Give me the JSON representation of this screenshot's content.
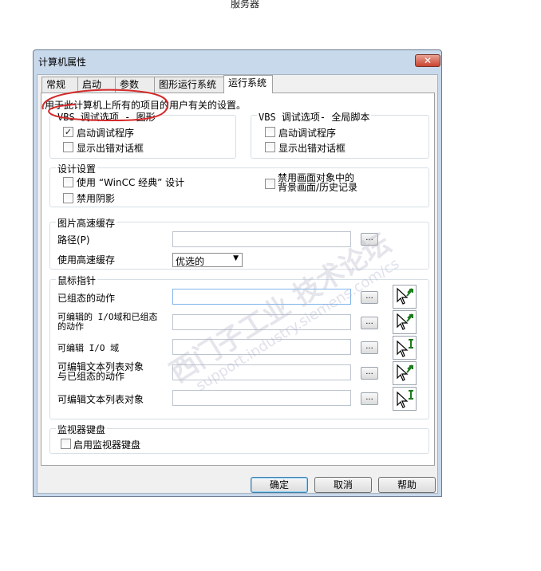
{
  "top_label": "服务器",
  "window": {
    "title": "计算机属性",
    "close": "✕"
  },
  "tabs": [
    "常规",
    "启动",
    "参数",
    "图形运行系统",
    "运行系统"
  ],
  "description": "用于此计算机上所有的项目的用户有关的设置。",
  "vbs_graphics": {
    "title": "VBS 调试选项 - 图形",
    "start_debugger": "启动调试程序",
    "show_error_dialog": "显示出错对话框"
  },
  "vbs_global": {
    "title": "VBS 调试选项- 全局脚本",
    "start_debugger": "启动调试程序",
    "show_error_dialog": "显示出错对话框"
  },
  "design": {
    "title": "设计设置",
    "classic_design": "使用 “WinCC 经典” 设计",
    "disable_shadow": "禁用阴影",
    "disable_screen_objects_line1": "禁用画面对象中的",
    "disable_screen_objects_line2": "背景画面/历史记录"
  },
  "image_cache": {
    "title": "图片高速缓存",
    "path_label": "路径(P)",
    "use_cache_label": "使用高速缓存",
    "use_cache_value": "优选的"
  },
  "mouse_pointer": {
    "title": "鼠标指针",
    "rows": [
      {
        "label1": "已组态的动作",
        "label2": ""
      },
      {
        "label1": "可编辑的 I/O域和已组态",
        "label2": "的动作"
      },
      {
        "label1": "可编辑 I/O 域",
        "label2": ""
      },
      {
        "label1": "可编辑文本列表对象",
        "label2": "与已组态的动作"
      },
      {
        "label1": "可编辑文本列表对象",
        "label2": ""
      }
    ],
    "dots": "..."
  },
  "monitor_keyboard": {
    "title": "监视器键盘",
    "enable": "启用监视器键盘"
  },
  "buttons": {
    "ok": "确定",
    "cancel": "取消",
    "help": "帮助"
  },
  "checked_mark": "✓",
  "watermark_text": "西门子工业 技术论坛",
  "watermark_url": "support.industry.siemens.com/cs",
  "colors": {
    "annotation": "#d42a2a",
    "cursor_arrow": "#000000",
    "cursor_accent": "#1e7a1e"
  }
}
